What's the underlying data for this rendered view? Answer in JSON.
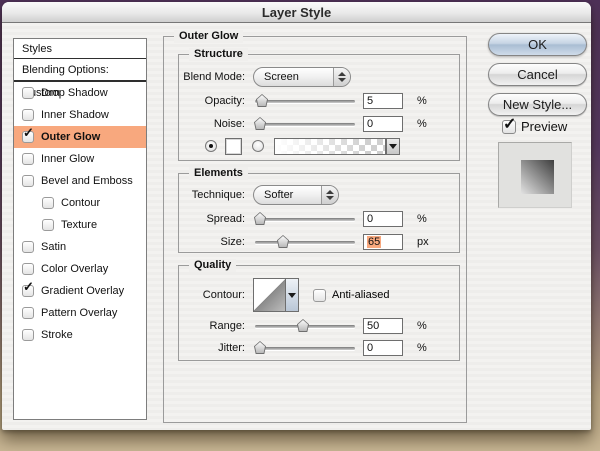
{
  "window": {
    "title": "Layer Style"
  },
  "sidebar": {
    "header": "Styles",
    "blending_options": "Blending Options: Custom",
    "items": [
      {
        "label": "Drop Shadow",
        "check": "",
        "indent": false,
        "selected": false
      },
      {
        "label": "Inner Shadow",
        "check": "",
        "indent": false,
        "selected": false
      },
      {
        "label": "Outer Glow",
        "check": "✓",
        "indent": false,
        "selected": true
      },
      {
        "label": "Inner Glow",
        "check": "",
        "indent": false,
        "selected": false
      },
      {
        "label": "Bevel and Emboss",
        "check": "",
        "indent": false,
        "selected": false
      },
      {
        "label": "Contour",
        "check": "",
        "indent": true,
        "selected": false
      },
      {
        "label": "Texture",
        "check": "",
        "indent": true,
        "selected": false
      },
      {
        "label": "Satin",
        "check": "",
        "indent": false,
        "selected": false
      },
      {
        "label": "Color Overlay",
        "check": "",
        "indent": false,
        "selected": false
      },
      {
        "label": "Gradient Overlay",
        "check": "✓",
        "indent": false,
        "selected": false
      },
      {
        "label": "Pattern Overlay",
        "check": "",
        "indent": false,
        "selected": false
      },
      {
        "label": "Stroke",
        "check": "",
        "indent": false,
        "selected": false
      }
    ]
  },
  "panel": {
    "group_title": "Outer Glow",
    "structure": {
      "title": "Structure",
      "blend_mode_label": "Blend Mode:",
      "blend_mode_value": "Screen",
      "opacity_label": "Opacity:",
      "opacity_value": "5",
      "opacity_unit": "%",
      "noise_label": "Noise:",
      "noise_value": "0",
      "noise_unit": "%"
    },
    "elements": {
      "title": "Elements",
      "technique_label": "Technique:",
      "technique_value": "Softer",
      "spread_label": "Spread:",
      "spread_value": "0",
      "spread_unit": "%",
      "size_label": "Size:",
      "size_value": "65",
      "size_unit": "px",
      "size_value_selected": true
    },
    "quality": {
      "title": "Quality",
      "contour_label": "Contour:",
      "antialiased_label": "Anti-aliased",
      "range_label": "Range:",
      "range_value": "50",
      "range_unit": "%",
      "jitter_label": "Jitter:",
      "jitter_value": "0",
      "jitter_unit": "%"
    }
  },
  "actions": {
    "ok": "OK",
    "cancel": "Cancel",
    "new_style": "New Style...",
    "preview": "Preview",
    "preview_check": "✓"
  },
  "colors": {
    "selection_highlight": "#F8A87E",
    "ok_button_tint": "#A9BDD3",
    "window_border_purple": "#553763",
    "desktop_tan": "#C9B795"
  }
}
